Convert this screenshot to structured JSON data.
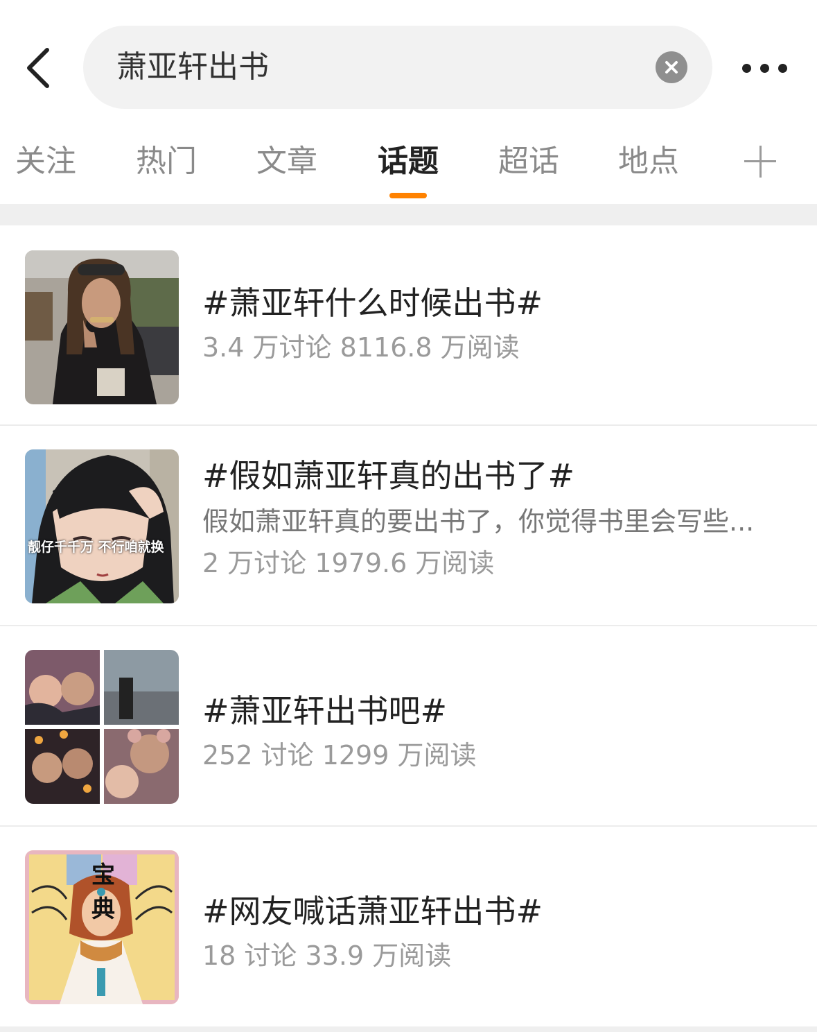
{
  "header": {
    "search_value": "萧亚轩出书",
    "back_icon": "chevron-left-icon",
    "clear_icon": "close-circle-icon",
    "more_icon": "more-dots-icon"
  },
  "tabs": [
    {
      "label": "关注"
    },
    {
      "label": "热门"
    },
    {
      "label": "文章"
    },
    {
      "label": "话题",
      "active": true
    },
    {
      "label": "超话"
    },
    {
      "label": "地点"
    }
  ],
  "tab_add_icon": "plus-icon",
  "accent_color": "#ff8200",
  "topics": [
    {
      "title": "#萧亚轩什么时候出书#",
      "stats": "3.4 万讨论 8116.8 万阅读"
    },
    {
      "title": "#假如萧亚轩真的出书了#",
      "description": "假如萧亚轩真的要出书了，你觉得书里会写些...",
      "thumb_caption": "靓仔千千万 不行咱就换",
      "stats": "2 万讨论 1979.6 万阅读"
    },
    {
      "title": "#萧亚轩出书吧#",
      "stats": "252 讨论 1299 万阅读"
    },
    {
      "title": "#网友喊话萧亚轩出书#",
      "thumb_text": "宝典",
      "stats": "18 讨论 33.9 万阅读"
    }
  ]
}
